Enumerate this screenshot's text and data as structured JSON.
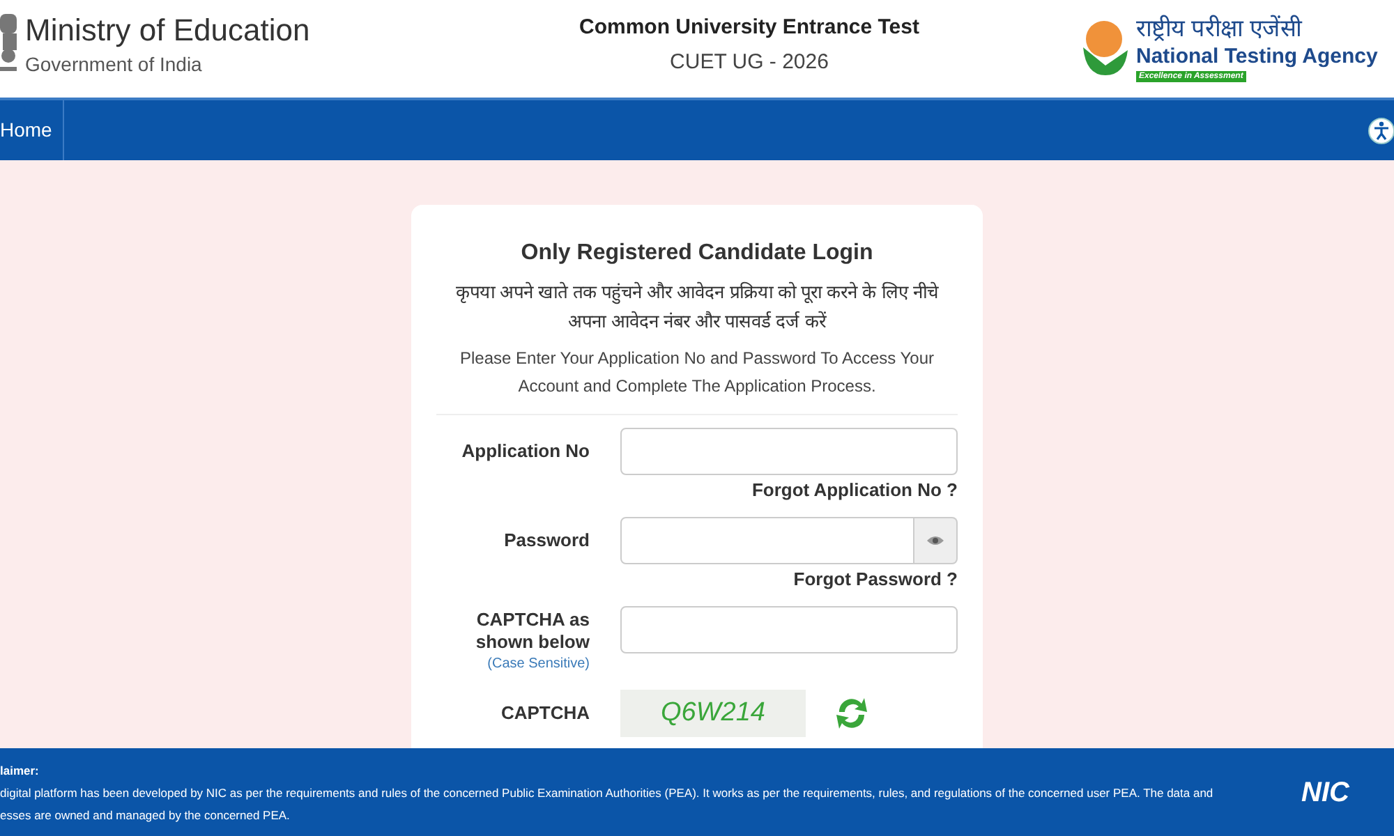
{
  "header": {
    "ministry": "Ministry of Education",
    "government": "Government of India",
    "exam_title": "Common University Entrance Test",
    "exam_subtitle": "CUET UG - 2026",
    "agency_hindi": "राष्ट्रीय परीक्षा एजेंसी",
    "agency_name": "National Testing Agency",
    "agency_tagline": "Excellence in Assessment"
  },
  "nav": {
    "items": [
      {
        "label": "Home",
        "selected": false
      }
    ]
  },
  "login": {
    "title": "Only Registered Candidate Login",
    "hindi_instruction": "कृपया अपने खाते तक पहुंचने और आवेदन प्रक्रिया को पूरा करने के लिए नीचे अपना आवेदन नंबर और पासवर्ड दर्ज करें",
    "instruction": "Please Enter Your Application No and Password To Access Your Account and Complete The Application Process.",
    "fields": [
      {
        "kind": "text",
        "label": "Application No",
        "link": "Forgot Application No ?"
      },
      {
        "kind": "password",
        "label": "Password",
        "link": "Forgot Password ?"
      },
      {
        "kind": "captcha_input",
        "label": "CAPTCHA as shown below",
        "note": "(Case Sensitive)"
      },
      {
        "kind": "captcha_image",
        "label": "CAPTCHA",
        "code": "Q6W214"
      }
    ]
  },
  "footer": {
    "heading": "laimer:",
    "text": "digital platform has been developed by NIC as per the requirements and rules of the concerned Public Examination Authorities (PEA). It works as per the requirements, rules, and regulations of the concerned user PEA. The data and",
    "text_cont": "esses are owned and managed by the concerned PEA.",
    "logo": "NIC"
  }
}
